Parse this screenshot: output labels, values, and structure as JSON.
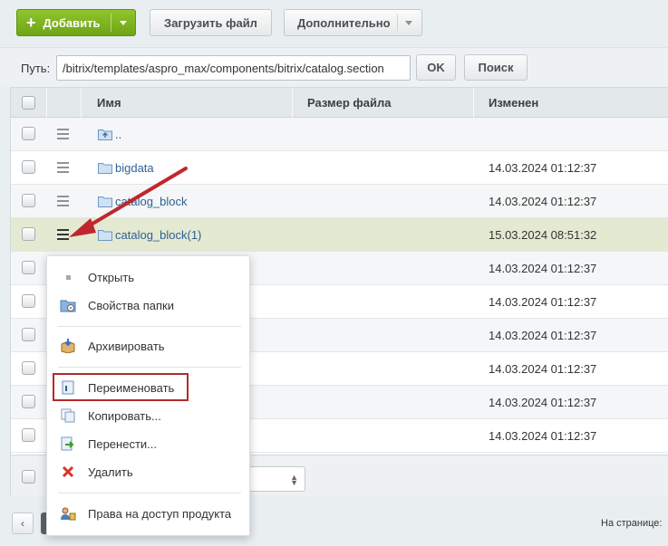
{
  "toolbar": {
    "add_label": "Добавить",
    "upload_label": "Загрузить файл",
    "more_label": "Дополнительно"
  },
  "path": {
    "label": "Путь:",
    "value": "/bitrix/templates/aspro_max/components/bitrix/catalog.section",
    "ok_label": "OK",
    "search_label": "Поиск"
  },
  "grid": {
    "columns": [
      "Имя",
      "Размер файла",
      "Изменен"
    ],
    "rows": [
      {
        "name": "..",
        "date": "",
        "icon": "folder-up-icon"
      },
      {
        "name": "bigdata",
        "date": "14.03.2024 01:12:37",
        "icon": "folder-icon"
      },
      {
        "name": "catalog_block",
        "date": "14.03.2024 01:12:37",
        "icon": "folder-icon"
      },
      {
        "name": "catalog_block(1)",
        "date": "15.03.2024 08:51:32",
        "icon": "folder-icon",
        "selected": true
      },
      {
        "name": "",
        "date": "14.03.2024 01:12:37"
      },
      {
        "name": "",
        "date": "14.03.2024 01:12:37"
      },
      {
        "name": "",
        "date": "14.03.2024 01:12:37"
      },
      {
        "name": "",
        "date": "14.03.2024 01:12:37"
      },
      {
        "name": "",
        "date": "14.03.2024 01:12:37"
      },
      {
        "name": "",
        "date": "14.03.2024 01:12:37"
      }
    ]
  },
  "context_menu": {
    "items": [
      {
        "label": "Открыть",
        "icon": "dot-icon"
      },
      {
        "label": "Свойства папки",
        "icon": "folder-properties-icon"
      },
      {
        "label": "Архивировать",
        "icon": "archive-icon"
      },
      {
        "label": "Переименовать",
        "icon": "rename-icon",
        "highlighted": true
      },
      {
        "label": "Копировать...",
        "icon": "copy-icon"
      },
      {
        "label": "Перенести...",
        "icon": "move-icon"
      },
      {
        "label": "Удалить",
        "icon": "delete-icon"
      },
      {
        "label": "Права на доступ продукта",
        "icon": "access-rights-icon"
      }
    ]
  },
  "footer": {
    "per_page_label": "На странице:"
  },
  "colors": {
    "add_button": "#7cb51f",
    "selected_row": "#e4e9d1",
    "annotation": "#c0272d",
    "link": "#2f5f96"
  }
}
